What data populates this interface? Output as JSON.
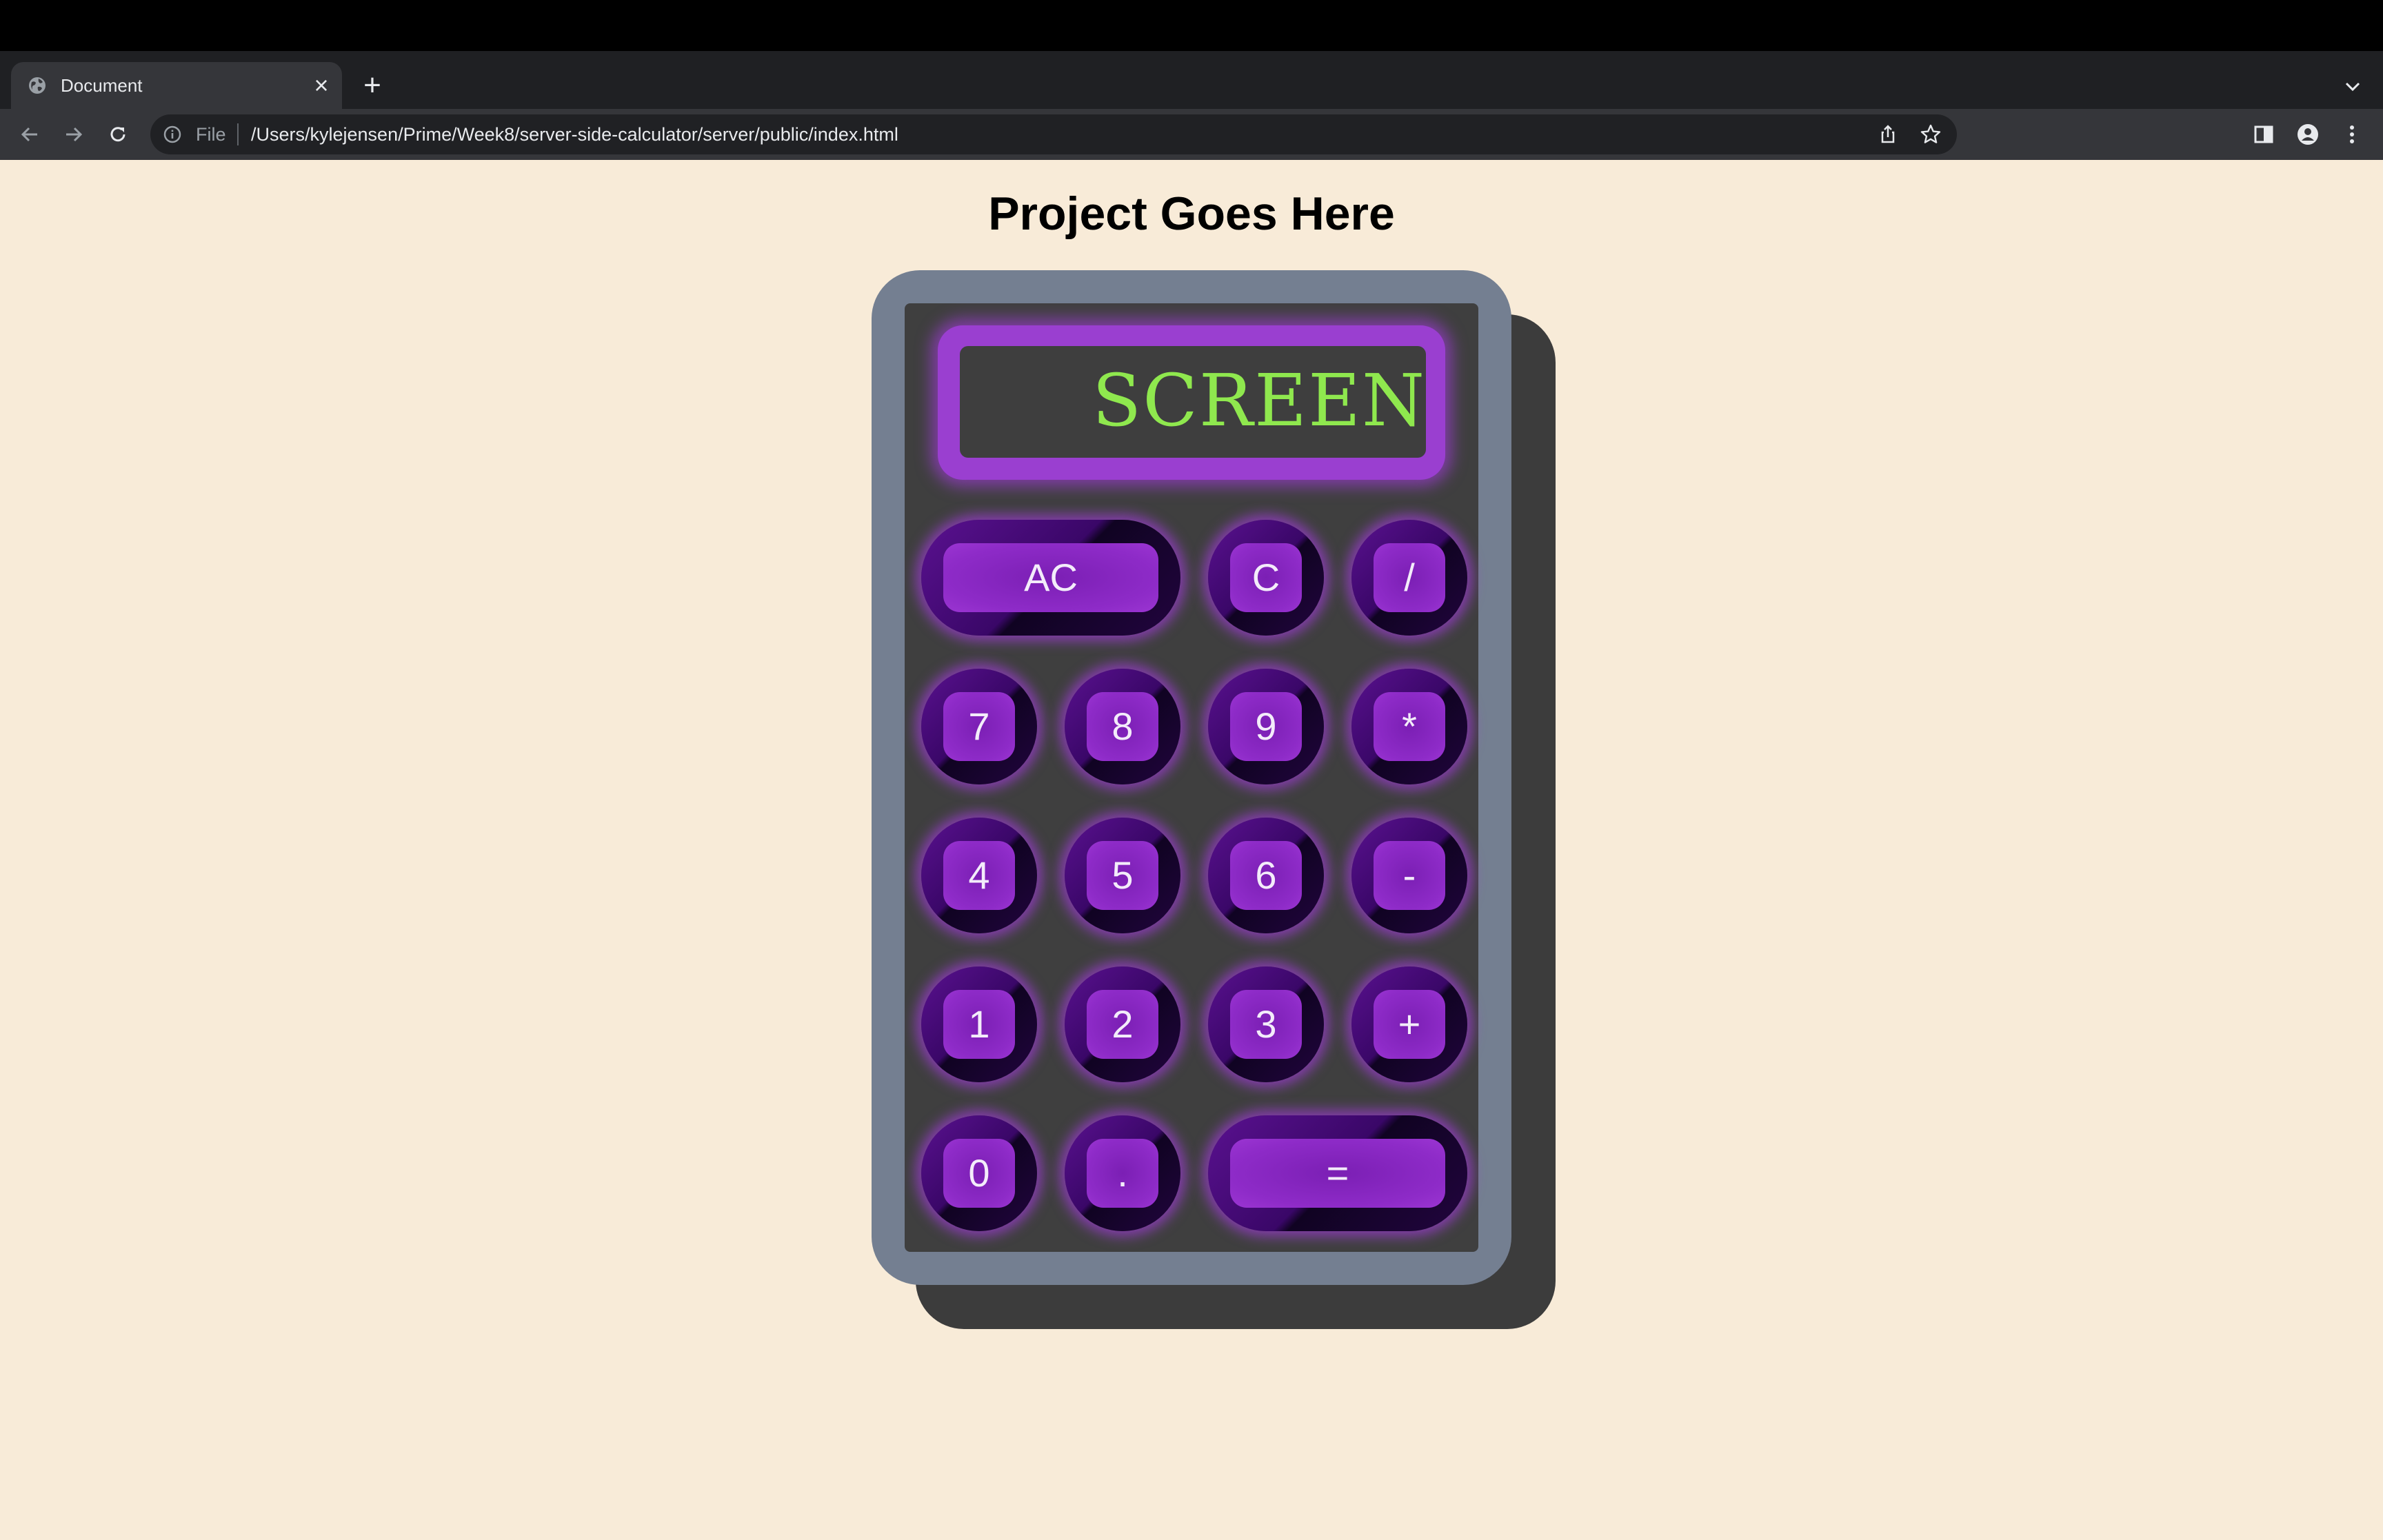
{
  "browser": {
    "tab_title": "Document",
    "close_glyph": "×",
    "newtab_glyph": "+",
    "url_scheme": "File",
    "url": "/Users/kylejensen/Prime/Week8/server-side-calculator/server/public/index.html",
    "icons": [
      "globe-icon",
      "close-icon",
      "plus-icon",
      "chevron-down-icon",
      "back-arrow-icon",
      "forward-arrow-icon",
      "reload-icon",
      "info-icon",
      "share-icon",
      "star-icon",
      "side-panel-icon",
      "profile-icon",
      "kebab-menu-icon"
    ]
  },
  "page": {
    "heading": "Project Goes Here"
  },
  "calculator": {
    "screen_text": "SCREEN",
    "colors": {
      "background": "#F8EBD8",
      "body": "#747F91",
      "panel": "#3F3F3F",
      "glow": "#9A3FD0",
      "screen_text": "#8FE84E"
    },
    "rows": [
      [
        {
          "label": "AC",
          "name": "clear-all-button"
        },
        {
          "label": "C",
          "name": "clear-button"
        },
        {
          "label": "/",
          "name": "divide-button"
        }
      ],
      [
        {
          "label": "7",
          "name": "digit-7-button"
        },
        {
          "label": "8",
          "name": "digit-8-button"
        },
        {
          "label": "9",
          "name": "digit-9-button"
        },
        {
          "label": "*",
          "name": "multiply-button"
        }
      ],
      [
        {
          "label": "4",
          "name": "digit-4-button"
        },
        {
          "label": "5",
          "name": "digit-5-button"
        },
        {
          "label": "6",
          "name": "digit-6-button"
        },
        {
          "label": "-",
          "name": "subtract-button"
        }
      ],
      [
        {
          "label": "1",
          "name": "digit-1-button"
        },
        {
          "label": "2",
          "name": "digit-2-button"
        },
        {
          "label": "3",
          "name": "digit-3-button"
        },
        {
          "label": "+",
          "name": "add-button"
        }
      ],
      [
        {
          "label": "0",
          "name": "digit-0-button"
        },
        {
          "label": ".",
          "name": "decimal-button"
        },
        {
          "label": "=",
          "name": "equals-button"
        }
      ]
    ]
  }
}
